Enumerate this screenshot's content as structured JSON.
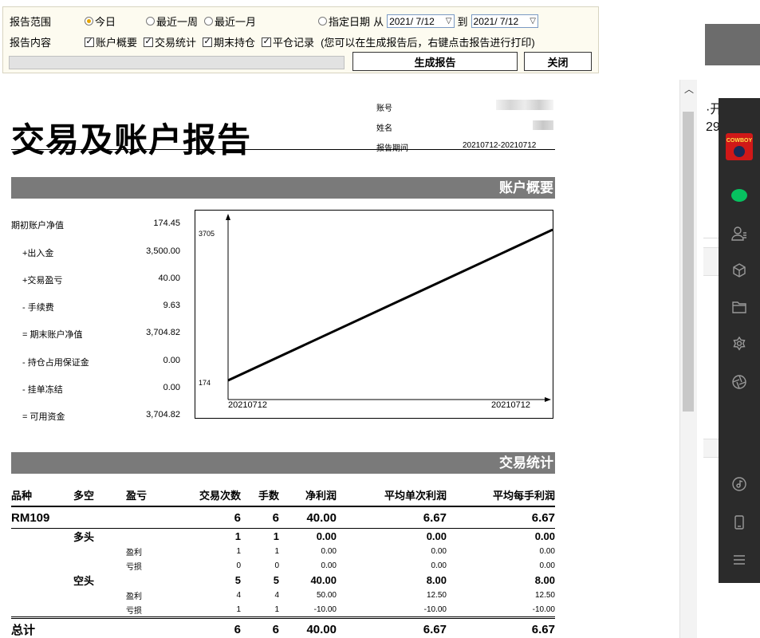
{
  "panel": {
    "range_label": "报告范围",
    "range_options": [
      {
        "label": "今日",
        "selected": true
      },
      {
        "label": "最近一周",
        "selected": false
      },
      {
        "label": "最近一月",
        "selected": false
      }
    ],
    "specify_date": {
      "label": "指定日期",
      "from_label": "从",
      "from_value": "2021/ 7/12",
      "to_label": "到",
      "to_value": "2021/ 7/12",
      "selected": false
    },
    "content_label": "报告内容",
    "content_options": [
      {
        "label": "账户概要",
        "checked": true
      },
      {
        "label": "交易统计",
        "checked": true
      },
      {
        "label": "期末持仓",
        "checked": true
      },
      {
        "label": "平仓记录",
        "checked": true
      }
    ],
    "hint": "(您可以在生成报告后，右键点击报告进行打印)",
    "generate_label": "生成报告",
    "close_label": "关闭",
    "check_glyph": "✓"
  },
  "report": {
    "title": "交易及账户报告",
    "meta": {
      "account_label": "账号",
      "name_label": "姓名",
      "period_label": "报告期间",
      "period_value": "20210712-20210712"
    },
    "summary_title": "账户概要",
    "summary": [
      {
        "label": "期初账户净值",
        "value": "174.45"
      },
      {
        "label": "+出入金",
        "value": "3,500.00"
      },
      {
        "label": "+交易盈亏",
        "value": "40.00"
      },
      {
        "label": "- 手续费",
        "value": "9.63"
      },
      {
        "label": "= 期末账户净值",
        "value": "3,704.82"
      },
      {
        "label": "- 持仓占用保证金",
        "value": "0.00"
      },
      {
        "label": "- 挂单冻结",
        "value": "0.00"
      },
      {
        "label": "= 可用资金",
        "value": "3,704.82"
      }
    ],
    "stats_title": "交易统计",
    "stats_headers": [
      "品种",
      "多空",
      "盈亏",
      "交易次数",
      "手数",
      "净利润",
      "平均单次利润",
      "平均每手利润"
    ],
    "stats_rows": [
      {
        "level": "product",
        "cells": [
          "RM109",
          "",
          "",
          "6",
          "6",
          "40.00",
          "6.67",
          "6.67"
        ]
      },
      {
        "level": "side",
        "cells": [
          "",
          "多头",
          "",
          "1",
          "1",
          "0.00",
          "0.00",
          "0.00"
        ]
      },
      {
        "level": "detail",
        "cells": [
          "",
          "",
          "盈利",
          "1",
          "1",
          "0.00",
          "0.00",
          "0.00"
        ]
      },
      {
        "level": "detail",
        "cells": [
          "",
          "",
          "亏损",
          "0",
          "0",
          "0.00",
          "0.00",
          "0.00"
        ]
      },
      {
        "level": "side",
        "cells": [
          "",
          "空头",
          "",
          "5",
          "5",
          "40.00",
          "8.00",
          "8.00"
        ]
      },
      {
        "level": "detail",
        "cells": [
          "",
          "",
          "盈利",
          "4",
          "4",
          "50.00",
          "12.50",
          "12.50"
        ]
      },
      {
        "level": "detail",
        "cells": [
          "",
          "",
          "亏损",
          "1",
          "1",
          "-10.00",
          "-10.00",
          "-10.00"
        ]
      },
      {
        "level": "total",
        "cells": [
          "总计",
          "",
          "",
          "6",
          "6",
          "40.00",
          "6.67",
          "6.67"
        ]
      }
    ]
  },
  "chart_data": {
    "type": "line",
    "x": [
      "20210712",
      "20210712"
    ],
    "series": [
      {
        "values": [
          174,
          3705
        ]
      }
    ],
    "ylim": [
      174,
      3705
    ],
    "y_ticks": [
      "3705",
      "174"
    ],
    "x_ticks": [
      "20210712",
      "20210712"
    ],
    "title": "",
    "xlabel": "",
    "ylabel": "",
    "grid": false
  },
  "right_window": {
    "text_line1": "·开",
    "text_line2": "29"
  },
  "sidebar": {
    "avatar_text": "COWBOY"
  },
  "colors": {
    "section_bar": "#7a7a7a",
    "panel_bg": "#fdfbf0",
    "sidebar_bg": "#2b2b2b",
    "chat_green": "#07c160",
    "radio_selected": "#e7a500"
  }
}
